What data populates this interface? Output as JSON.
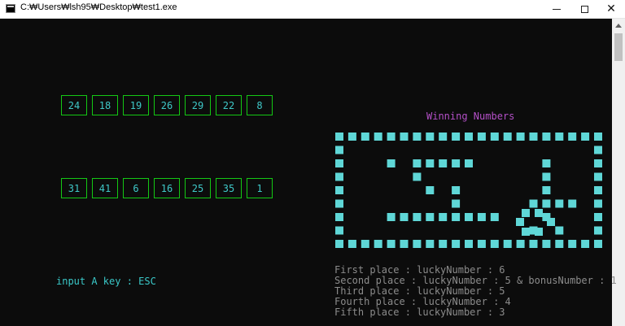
{
  "window": {
    "title": "C:₩Users₩lsh95₩Desktop₩test1.exe",
    "close_glyph": "✕"
  },
  "console": {
    "row1": [
      "24",
      "18",
      "19",
      "26",
      "29",
      "22",
      "8"
    ],
    "row2": [
      "31",
      "41",
      "6",
      "16",
      "25",
      "35",
      "1"
    ],
    "input_label": "input A key : ESC",
    "winning_title": "Winning Numbers",
    "results": [
      "First place : luckyNumber : 6",
      "Second place : luckyNumber : 5 & bonusNumber : 1",
      "Third place : luckyNumber : 5",
      "Fourth place : luckyNumber : 4",
      "Fifth place : luckyNumber : 3"
    ]
  },
  "colors": {
    "background": "#0c0c0c",
    "box_border": "#14c814",
    "number_text": "#3fc8c8",
    "block": "#5fd7d7",
    "winning_title": "#b450c8",
    "results_text": "#8c8c8c"
  }
}
